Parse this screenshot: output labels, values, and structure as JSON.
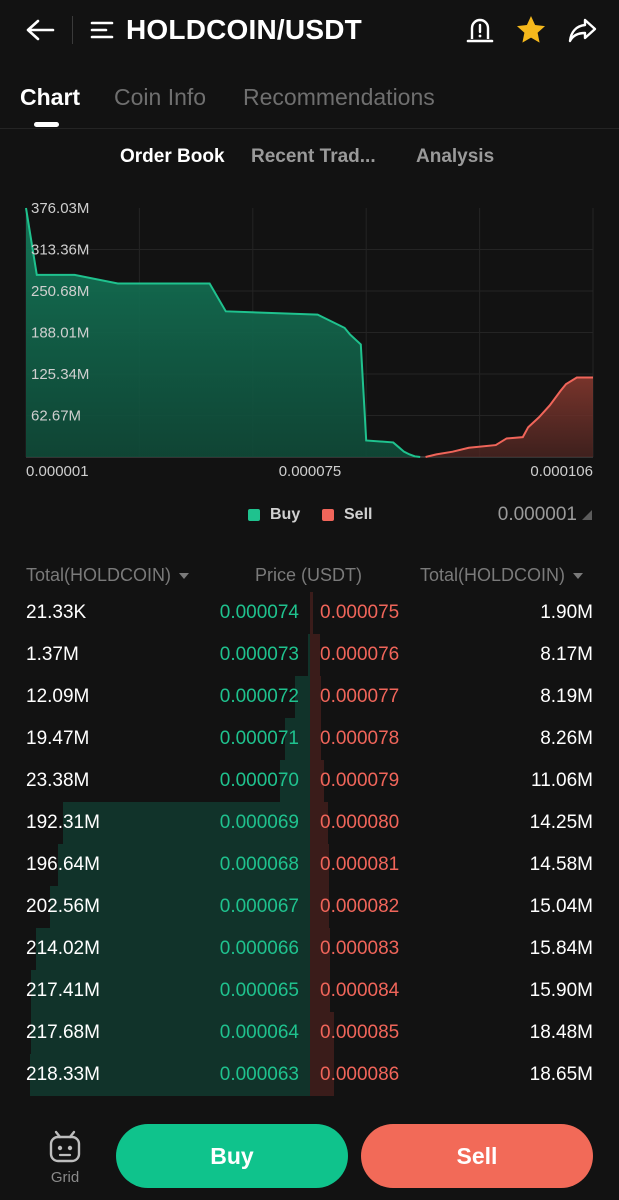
{
  "header": {
    "title": "HOLDCOIN/USDT",
    "icons": [
      "back-arrow-icon",
      "menu-list-icon",
      "price-alert-icon",
      "favorite-star-icon",
      "share-icon"
    ],
    "star_color": "#f5b81c"
  },
  "main_tabs": [
    {
      "label": "Chart",
      "active": true
    },
    {
      "label": "Coin Info",
      "active": false
    },
    {
      "label": "Recommendations",
      "active": false
    }
  ],
  "sub_tabs": [
    {
      "label": "Order Book",
      "active": true
    },
    {
      "label": "Recent Trad...",
      "active": false
    },
    {
      "label": "Analysis",
      "active": false
    }
  ],
  "chart_data": {
    "type": "area",
    "y_tick_labels": [
      "376.03M",
      "313.36M",
      "250.68M",
      "188.01M",
      "125.34M",
      "62.67M"
    ],
    "y_ticks": [
      376.03,
      313.36,
      250.68,
      188.01,
      125.34,
      62.67
    ],
    "x_tick_labels": [
      "0.000001",
      "0.000075",
      "0.000106"
    ],
    "ylim": [
      0,
      376.03
    ],
    "grid": true,
    "series": [
      {
        "name": "Buy",
        "color": "#1fc28e",
        "x": [
          1e-06,
          3e-06,
          1e-05,
          1.8e-05,
          3.5e-05,
          3.8e-05,
          5.5e-05,
          6e-05,
          6.1e-05,
          6.3e-05,
          6.4e-05,
          6.9e-05,
          7e-05,
          7.1e-05,
          7.2e-05,
          7.3e-05,
          7.4e-05
        ],
        "y": [
          376,
          275,
          275,
          262,
          262,
          220,
          215,
          195,
          185,
          170,
          25,
          22,
          15,
          8,
          4,
          1,
          0
        ]
      },
      {
        "name": "Sell",
        "color": "#f0655a",
        "x": [
          7.5e-05,
          7.7e-05,
          8e-05,
          8.3e-05,
          8.8e-05,
          9e-05,
          9.3e-05,
          9.4e-05,
          9.6e-05,
          9.8e-05,
          0.0001,
          0.000101,
          0.000103,
          0.000106
        ],
        "y": [
          0,
          4,
          8,
          14,
          18,
          28,
          30,
          45,
          60,
          78,
          100,
          110,
          120,
          120
        ]
      }
    ]
  },
  "legend": {
    "buy_label": "Buy",
    "sell_label": "Sell",
    "buy_color": "#1fc28e",
    "sell_color": "#f0655a",
    "precision": "0.000001"
  },
  "order_book": {
    "headers": {
      "left": "Total(HOLDCOIN)",
      "middle": "Price (USDT)",
      "right": "Total(HOLDCOIN)"
    },
    "rows": [
      {
        "bid_qty": "21.33K",
        "bid_price": "0.000074",
        "ask_price": "0.000075",
        "ask_qty": "1.90M",
        "bid_depth": 0.0001,
        "ask_depth": 0.009
      },
      {
        "bid_qty": "1.37M",
        "bid_price": "0.000073",
        "ask_price": "0.000076",
        "ask_qty": "8.17M",
        "bid_depth": 0.006,
        "ask_depth": 0.037
      },
      {
        "bid_qty": "12.09M",
        "bid_price": "0.000072",
        "ask_price": "0.000077",
        "ask_qty": "8.19M",
        "bid_depth": 0.055,
        "ask_depth": 0.038
      },
      {
        "bid_qty": "19.47M",
        "bid_price": "0.000071",
        "ask_price": "0.000078",
        "ask_qty": "8.26M",
        "bid_depth": 0.089,
        "ask_depth": 0.038
      },
      {
        "bid_qty": "23.38M",
        "bid_price": "0.000070",
        "ask_price": "0.000079",
        "ask_qty": "11.06M",
        "bid_depth": 0.107,
        "ask_depth": 0.051
      },
      {
        "bid_qty": "192.31M",
        "bid_price": "0.000069",
        "ask_price": "0.000080",
        "ask_qty": "14.25M",
        "bid_depth": 0.881,
        "ask_depth": 0.065
      },
      {
        "bid_qty": "196.64M",
        "bid_price": "0.000068",
        "ask_price": "0.000081",
        "ask_qty": "14.58M",
        "bid_depth": 0.901,
        "ask_depth": 0.067
      },
      {
        "bid_qty": "202.56M",
        "bid_price": "0.000067",
        "ask_price": "0.000082",
        "ask_qty": "15.04M",
        "bid_depth": 0.928,
        "ask_depth": 0.069
      },
      {
        "bid_qty": "214.02M",
        "bid_price": "0.000066",
        "ask_price": "0.000083",
        "ask_qty": "15.84M",
        "bid_depth": 0.98,
        "ask_depth": 0.073
      },
      {
        "bid_qty": "217.41M",
        "bid_price": "0.000065",
        "ask_price": "0.000084",
        "ask_qty": "15.90M",
        "bid_depth": 0.996,
        "ask_depth": 0.073
      },
      {
        "bid_qty": "217.68M",
        "bid_price": "0.000064",
        "ask_price": "0.000085",
        "ask_qty": "18.48M",
        "bid_depth": 0.997,
        "ask_depth": 0.085
      },
      {
        "bid_qty": "218.33M",
        "bid_price": "0.000063",
        "ask_price": "0.000086",
        "ask_qty": "18.65M",
        "bid_depth": 1.0,
        "ask_depth": 0.085
      }
    ]
  },
  "bottom_bar": {
    "grid_label": "Grid",
    "buy_label": "Buy",
    "sell_label": "Sell",
    "buy_color": "#0fc38c",
    "sell_color": "#f26a58"
  }
}
